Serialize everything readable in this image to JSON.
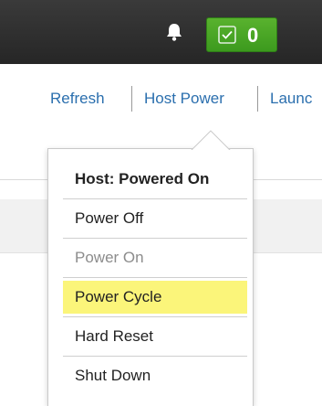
{
  "header": {
    "notification_icon": "bell-icon",
    "status_icon": "checkbox-icon",
    "status_count": "0",
    "status_color": "#4aa825"
  },
  "toolbar": {
    "refresh_label": "Refresh",
    "host_power_label": "Host Power",
    "launch_label_partial": "Launc"
  },
  "power_menu": {
    "header": "Host: Powered On",
    "items": [
      {
        "label": "Power Off",
        "state": "enabled"
      },
      {
        "label": "Power On",
        "state": "disabled"
      },
      {
        "label": "Power Cycle",
        "state": "highlighted"
      },
      {
        "label": "Hard Reset",
        "state": "enabled"
      },
      {
        "label": "Shut Down",
        "state": "enabled"
      }
    ],
    "highlight_color": "#fbf57a"
  },
  "colors": {
    "link": "#2b6fae",
    "topbar": "#2e2e2e"
  }
}
